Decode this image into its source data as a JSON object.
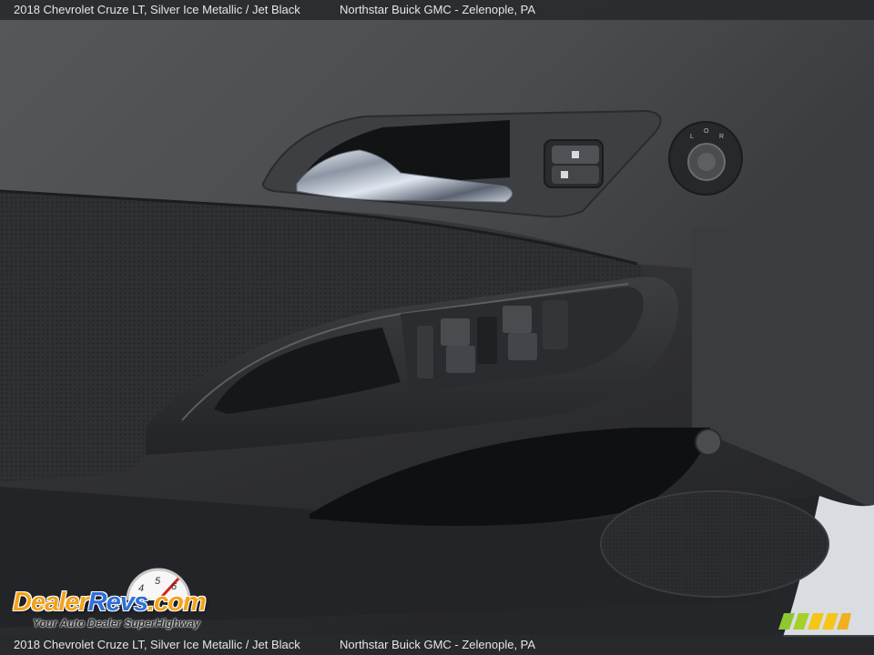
{
  "caption": {
    "top_left": "2018 Chevrolet Cruze LT,  Silver Ice Metallic / Jet Black",
    "top_right": "Northstar Buick GMC - Zelenople, PA",
    "bottom_left": "2018 Chevrolet Cruze LT,  Silver Ice Metallic / Jet Black",
    "bottom_right": "Northstar Buick GMC - Zelenople, PA"
  },
  "watermark": {
    "brand_part1": "Dealer",
    "brand_part2": "Revs",
    "brand_suffix": ".com",
    "tagline": "Your Auto Dealer SuperHighway",
    "gauge_digits": [
      "4",
      "5",
      "6"
    ]
  },
  "colors": {
    "panel_dark": "#2a2b2e",
    "panel_light": "#6b6d70",
    "chrome": "#cfd6e0",
    "brand_orange": "#f3a21a",
    "brand_blue": "#2e6fd8",
    "stripe_green": "#8bc832",
    "stripe_yellow": "#f5c518"
  }
}
